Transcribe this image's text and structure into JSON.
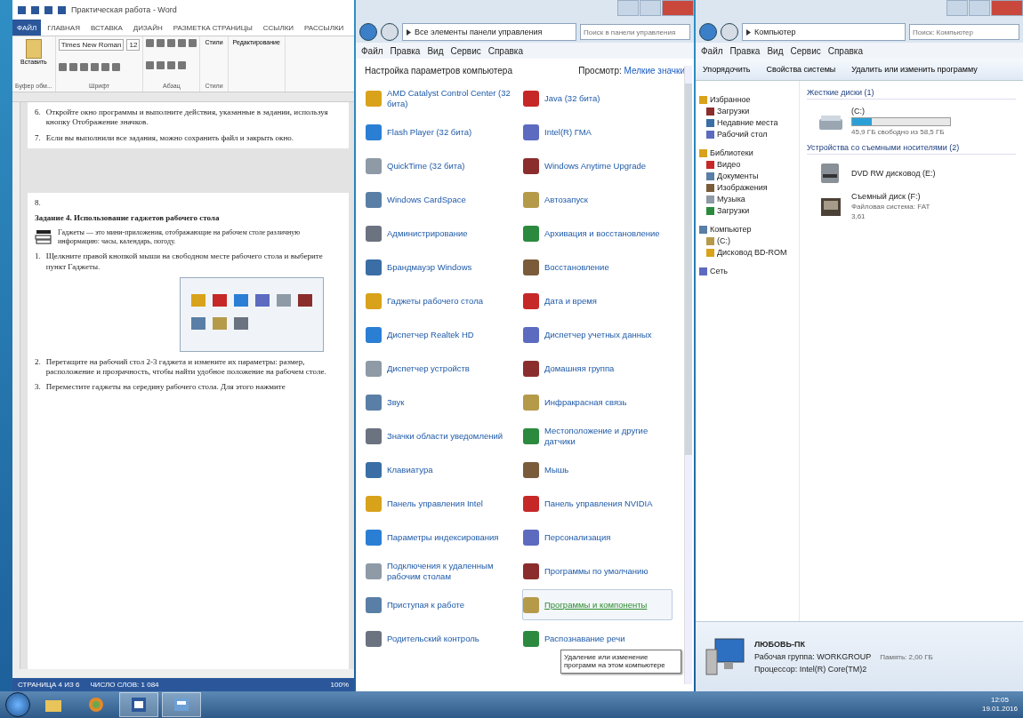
{
  "word": {
    "title": "Практическая работа - Word",
    "tabs": [
      {
        "label": "ФАЙЛ",
        "selected": true
      },
      {
        "label": "ГЛАВНАЯ",
        "selected": false
      },
      {
        "label": "ВСТАВКА",
        "selected": false
      },
      {
        "label": "ДИЗАЙН",
        "selected": false
      },
      {
        "label": "РАЗМЕТКА СТРАНИЦЫ",
        "selected": false
      },
      {
        "label": "ССЫЛКИ",
        "selected": false
      },
      {
        "label": "РАССЫЛКИ",
        "selected": false
      }
    ],
    "font_name": "Times New Roman",
    "font_size": "12",
    "ribbon_groups": [
      "Буфер обм...",
      "Шрифт",
      "Абзац",
      "Стили"
    ],
    "ribbon_buttons": [
      "Вставить",
      "Стили",
      "Редактирование"
    ],
    "paragraphs": [
      {
        "kind": "item",
        "number": "6.",
        "text": "Откройте окно программы и выполните действия, указанные в задании, используя кнопку Отображение значков."
      },
      {
        "kind": "item",
        "number": "7.",
        "text": "Если вы выполнили все задания, можно сохранить файл и закрыть окно."
      },
      {
        "kind": "break"
      },
      {
        "kind": "plain",
        "text": "8."
      },
      {
        "kind": "heading",
        "text": "Задание 4. Использование гаджетов рабочего стола"
      },
      {
        "kind": "note",
        "text": "Гаджеты — это мини-приложения, отображающие на рабочем столе различную информацию: часы, календарь, погоду."
      },
      {
        "kind": "item",
        "number": "1.",
        "text": "Щелкните правой кнопкой мыши на свободном месте рабочего стола и выберите пункт Гаджеты."
      },
      {
        "kind": "figure"
      },
      {
        "kind": "item",
        "number": "2.",
        "text": "Перетащите на рабочий стол 2-3 гаджета и измените их параметры: размер, расположение и прозрачность, чтобы найти удобное положение на рабочем столе."
      },
      {
        "kind": "item",
        "number": "3.",
        "text": "Переместите гаджеты на середину рабочего стола. Для этого нажмите"
      }
    ],
    "status": [
      "СТРАНИЦА 4 ИЗ 6",
      "ЧИСЛО СЛОВ: 1 084",
      "100%"
    ]
  },
  "control_panel": {
    "address": [
      "Все элементы панели управления"
    ],
    "search_placeholder": "Поиск в панели управления",
    "menu": [
      "Файл",
      "Правка",
      "Вид",
      "Сервис",
      "Справка"
    ],
    "heading": "Настройка параметров компьютера",
    "view_label": "Просмотр:",
    "view_value": "Мелкие значки",
    "items": [
      {
        "label": "AMD Catalyst Control Center (32 бита)"
      },
      {
        "label": "Java (32 бита)"
      },
      {
        "label": "Flash Player (32 бита)"
      },
      {
        "label": "Intel(R) ГМА"
      },
      {
        "label": "QuickTime (32 бита)"
      },
      {
        "label": "Windows Anytime Upgrade"
      },
      {
        "label": "Windows CardSpace"
      },
      {
        "label": "Автозапуск"
      },
      {
        "label": "Администрирование"
      },
      {
        "label": "Архивация и восстановление"
      },
      {
        "label": "Брандмауэр Windows"
      },
      {
        "label": "Восстановление"
      },
      {
        "label": "Гаджеты рабочего стола"
      },
      {
        "label": "Дата и время"
      },
      {
        "label": "Диспетчер Realtek HD"
      },
      {
        "label": "Диспетчер учетных данных"
      },
      {
        "label": "Диспетчер устройств"
      },
      {
        "label": "Домашняя группа"
      },
      {
        "label": "Звук"
      },
      {
        "label": "Инфракрасная связь"
      },
      {
        "label": "Значки области уведомлений"
      },
      {
        "label": "Местоположение и другие датчики"
      },
      {
        "label": "Клавиатура"
      },
      {
        "label": "Мышь"
      },
      {
        "label": "Панель управления Intel"
      },
      {
        "label": "Панель управления NVIDIA"
      },
      {
        "label": "Параметры индексирования"
      },
      {
        "label": "Персонализация"
      },
      {
        "label": "Подключения к удаленным рабочим столам"
      },
      {
        "label": "Программы по умолчанию"
      },
      {
        "label": "Приступая к работе"
      },
      {
        "label": "Программы и компоненты",
        "selected": true
      },
      {
        "label": "Родительский контроль"
      },
      {
        "label": "Распознавание речи"
      }
    ],
    "tooltip": "Удаление или изменение программ на этом компьютере"
  },
  "explorer": {
    "address": "Компьютер",
    "search_placeholder": "Поиск: Компьютер",
    "menu": [
      "Файл",
      "Правка",
      "Вид",
      "Сервис",
      "Справка"
    ],
    "toolbar": [
      "Упорядочить",
      "Свойства системы",
      "Удалить или изменить программу"
    ],
    "sidebar": [
      {
        "kind": "header",
        "label": "Избранное"
      },
      {
        "kind": "item",
        "label": "Загрузки"
      },
      {
        "kind": "item",
        "label": "Недавние места"
      },
      {
        "kind": "item",
        "label": "Рабочий стол"
      },
      {
        "kind": "header",
        "label": "Библиотеки"
      },
      {
        "kind": "item",
        "label": "Видео"
      },
      {
        "kind": "item",
        "label": "Документы"
      },
      {
        "kind": "item",
        "label": "Изображения"
      },
      {
        "kind": "item",
        "label": "Музыка"
      },
      {
        "kind": "item",
        "label": "Загрузки"
      },
      {
        "kind": "header",
        "label": "Компьютер"
      },
      {
        "kind": "item",
        "label": "(C:)"
      },
      {
        "kind": "item",
        "label": "Дисковод BD-ROM"
      },
      {
        "kind": "header",
        "label": "Сеть"
      }
    ],
    "groups": [
      {
        "heading": "Жесткие диски (1)",
        "drives": [
          {
            "kind": "disk",
            "name": "(C:)",
            "level": 0.2,
            "info": "45,9 ГБ свободно из 58,5 ГБ"
          }
        ]
      },
      {
        "heading": "Устройства со съемными носителями (2)",
        "drives": [
          {
            "kind": "dvd",
            "name": "DVD RW дисковод (E:)"
          },
          {
            "kind": "card",
            "name": "Съемный диск (F:)",
            "info": "Файловая система: FAT",
            "extra": "3,61"
          }
        ]
      }
    ],
    "details": {
      "name": "ЛЮБОВЬ-ПК",
      "domain": "Рабочая группа: WORKGROUP",
      "memory": "Память: 2,00 ГБ",
      "cpu": "Процессор: Intel(R) Core(TM)2"
    }
  },
  "taskbar": {
    "buttons": [
      {
        "kind": "folder",
        "selected": false
      },
      {
        "kind": "media",
        "selected": false
      },
      {
        "kind": "word",
        "selected": true
      },
      {
        "kind": "panel",
        "selected": true
      }
    ],
    "time": "12:05",
    "date": "19.01.2016"
  }
}
